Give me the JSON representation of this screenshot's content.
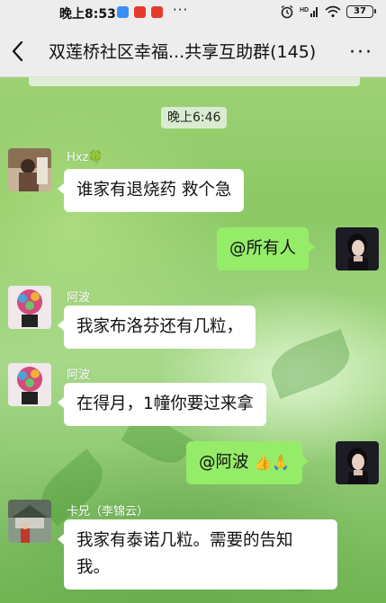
{
  "status_bar": {
    "time": "晚上8:53",
    "dots": "···",
    "battery": "37"
  },
  "header": {
    "title": "双莲桥社区幸福...共享互助群(145)",
    "more": "···"
  },
  "timestamp": "晚上6:46",
  "messages": [
    {
      "sender": "Hxz🍀",
      "text": "谁家有退烧药 救个急",
      "direction": "in"
    },
    {
      "sender": "",
      "text": "@所有人",
      "direction": "out"
    },
    {
      "sender": "阿波",
      "text": "我家布洛芬还有几粒，",
      "direction": "in"
    },
    {
      "sender": "阿波",
      "text": "在得月，1幢你要过来拿",
      "direction": "in"
    },
    {
      "sender": "",
      "text": "@阿波 ",
      "emoji": "👍🙏",
      "direction": "out"
    },
    {
      "sender": "卡兄（李锦云）",
      "text_line1": "我家有泰诺几粒。需要的告知",
      "text_line2": "我。",
      "direction": "in"
    }
  ],
  "colors": {
    "out_bubble": "#95ec69",
    "in_bubble": "#ffffff",
    "nav_bg": "#ededed"
  }
}
